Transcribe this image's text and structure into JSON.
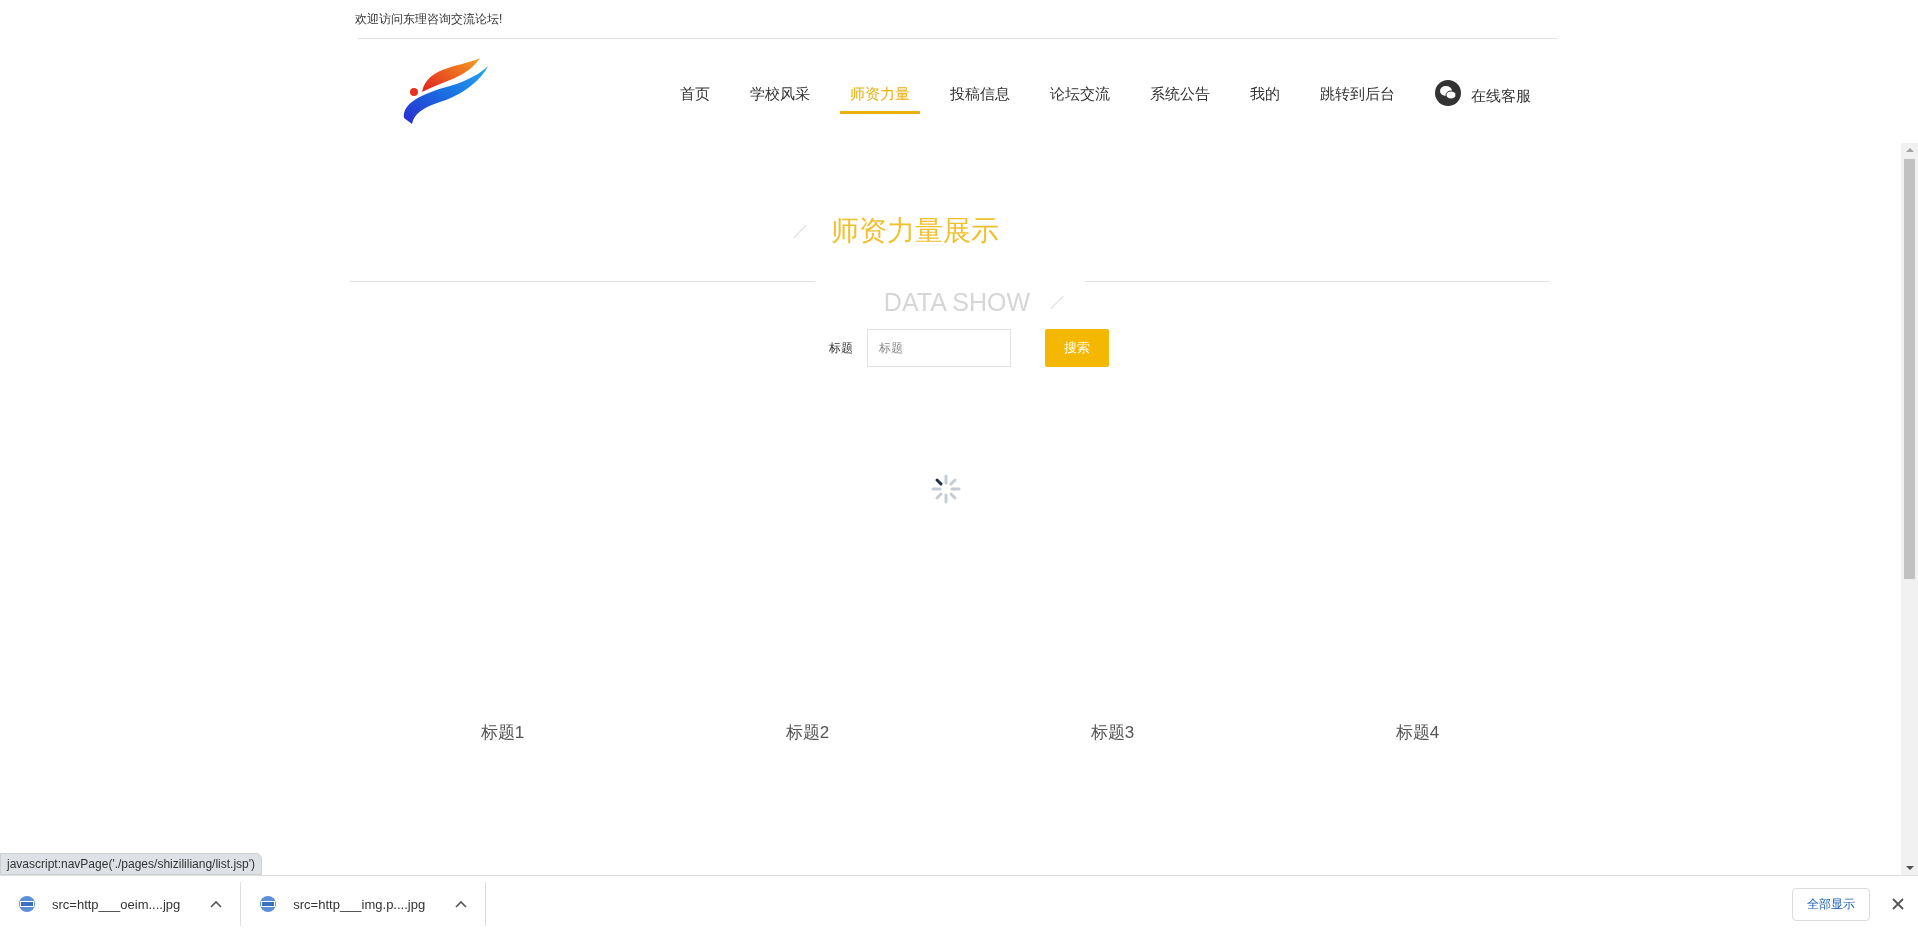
{
  "welcome": "欢迎访问东理咨询交流论坛!",
  "nav": [
    {
      "label": "首页",
      "selected": false
    },
    {
      "label": "学校风采",
      "selected": false
    },
    {
      "label": "师资力量",
      "selected": true
    },
    {
      "label": "投稿信息",
      "selected": false
    },
    {
      "label": "论坛交流",
      "selected": false
    },
    {
      "label": "系统公告",
      "selected": false
    },
    {
      "label": "我的",
      "selected": false
    },
    {
      "label": "跳转到后台",
      "selected": false
    }
  ],
  "service": "在线客服",
  "section": {
    "title": "师资力量展示",
    "subtitle": "DATA SHOW"
  },
  "search": {
    "label": "标题",
    "placeholder": "标题",
    "button": "搜索"
  },
  "items": [
    {
      "title": "标题1"
    },
    {
      "title": "标题2"
    },
    {
      "title": "标题3"
    },
    {
      "title": "标题4"
    }
  ],
  "status_url": "javascript:navPage('./pages/shizililiang/list.jsp')",
  "downloads": [
    {
      "name": "src=http___oeim....jpg"
    },
    {
      "name": "src=http___img.p....jpg"
    }
  ],
  "show_all": "全部显示"
}
